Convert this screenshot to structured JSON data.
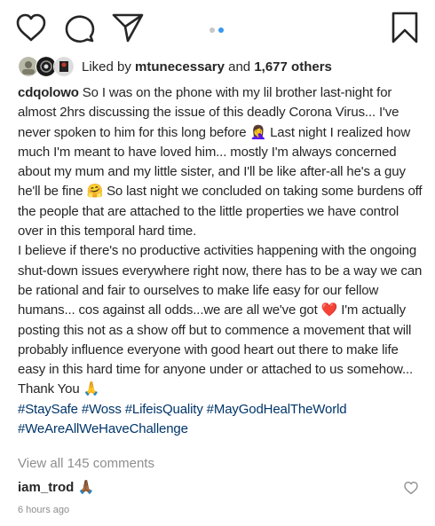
{
  "post": {
    "likes": {
      "prefix": "Liked by",
      "user": "mtunecessary",
      "connector": "and",
      "others": "1,677 others"
    },
    "caption": {
      "username": "cdqolowo",
      "paragraph1_part1": "So I was on the phone with my lil brother last-night for almost 2hrs discussing the issue of this deadly Corona Virus... I've never spoken to him for this long before",
      "emoji1": "🤦‍♀️",
      "paragraph1_part2": "Last night I realized how much I'm meant to have loved him... mostly I'm always concerned about my mum and my little sister, and I'll be like after-all he's a guy he'll be fine",
      "emoji2": "🤗",
      "paragraph1_part3": "So last night we concluded on taking some burdens off the people that are attached to the little properties we have control over in this temporal hard time.",
      "paragraph2_part1": "I believe if there's no productive activities happening with the ongoing shut-down issues everywhere right now, there has to be a way we can be rational and fair to ourselves to make life easy for our fellow humans... cos against all odds...we are all we've got",
      "emoji3": "❤️",
      "paragraph2_part2": "I'm actually posting this not as a show off but to commence a movement that will probably influence everyone with good heart out there to make life easy in this hard time for anyone under or attached to us somehow... Thank You",
      "emoji4": "🙏",
      "hashtags": "#StaySafe #Woss #LifeisQuality #MayGodHealTheWorld #WeAreAllWeHaveChallenge"
    },
    "view_comments": "View all 145 comments",
    "comment": {
      "user": "iam_trod",
      "text": "🙏🏾"
    },
    "timestamp": "6 hours ago"
  },
  "icons": {
    "like": "heart-outline-icon",
    "comment": "speech-bubble-icon",
    "share": "paper-plane-icon",
    "save": "bookmark-icon",
    "comment_like": "small-heart-icon"
  },
  "colors": {
    "text": "#262626",
    "muted": "#8e8e8e",
    "hashtag": "#003569",
    "active_dot": "#3897f0",
    "inactive_dot": "#c7c7c7"
  },
  "carousel": {
    "slides": 2,
    "active": 2
  }
}
